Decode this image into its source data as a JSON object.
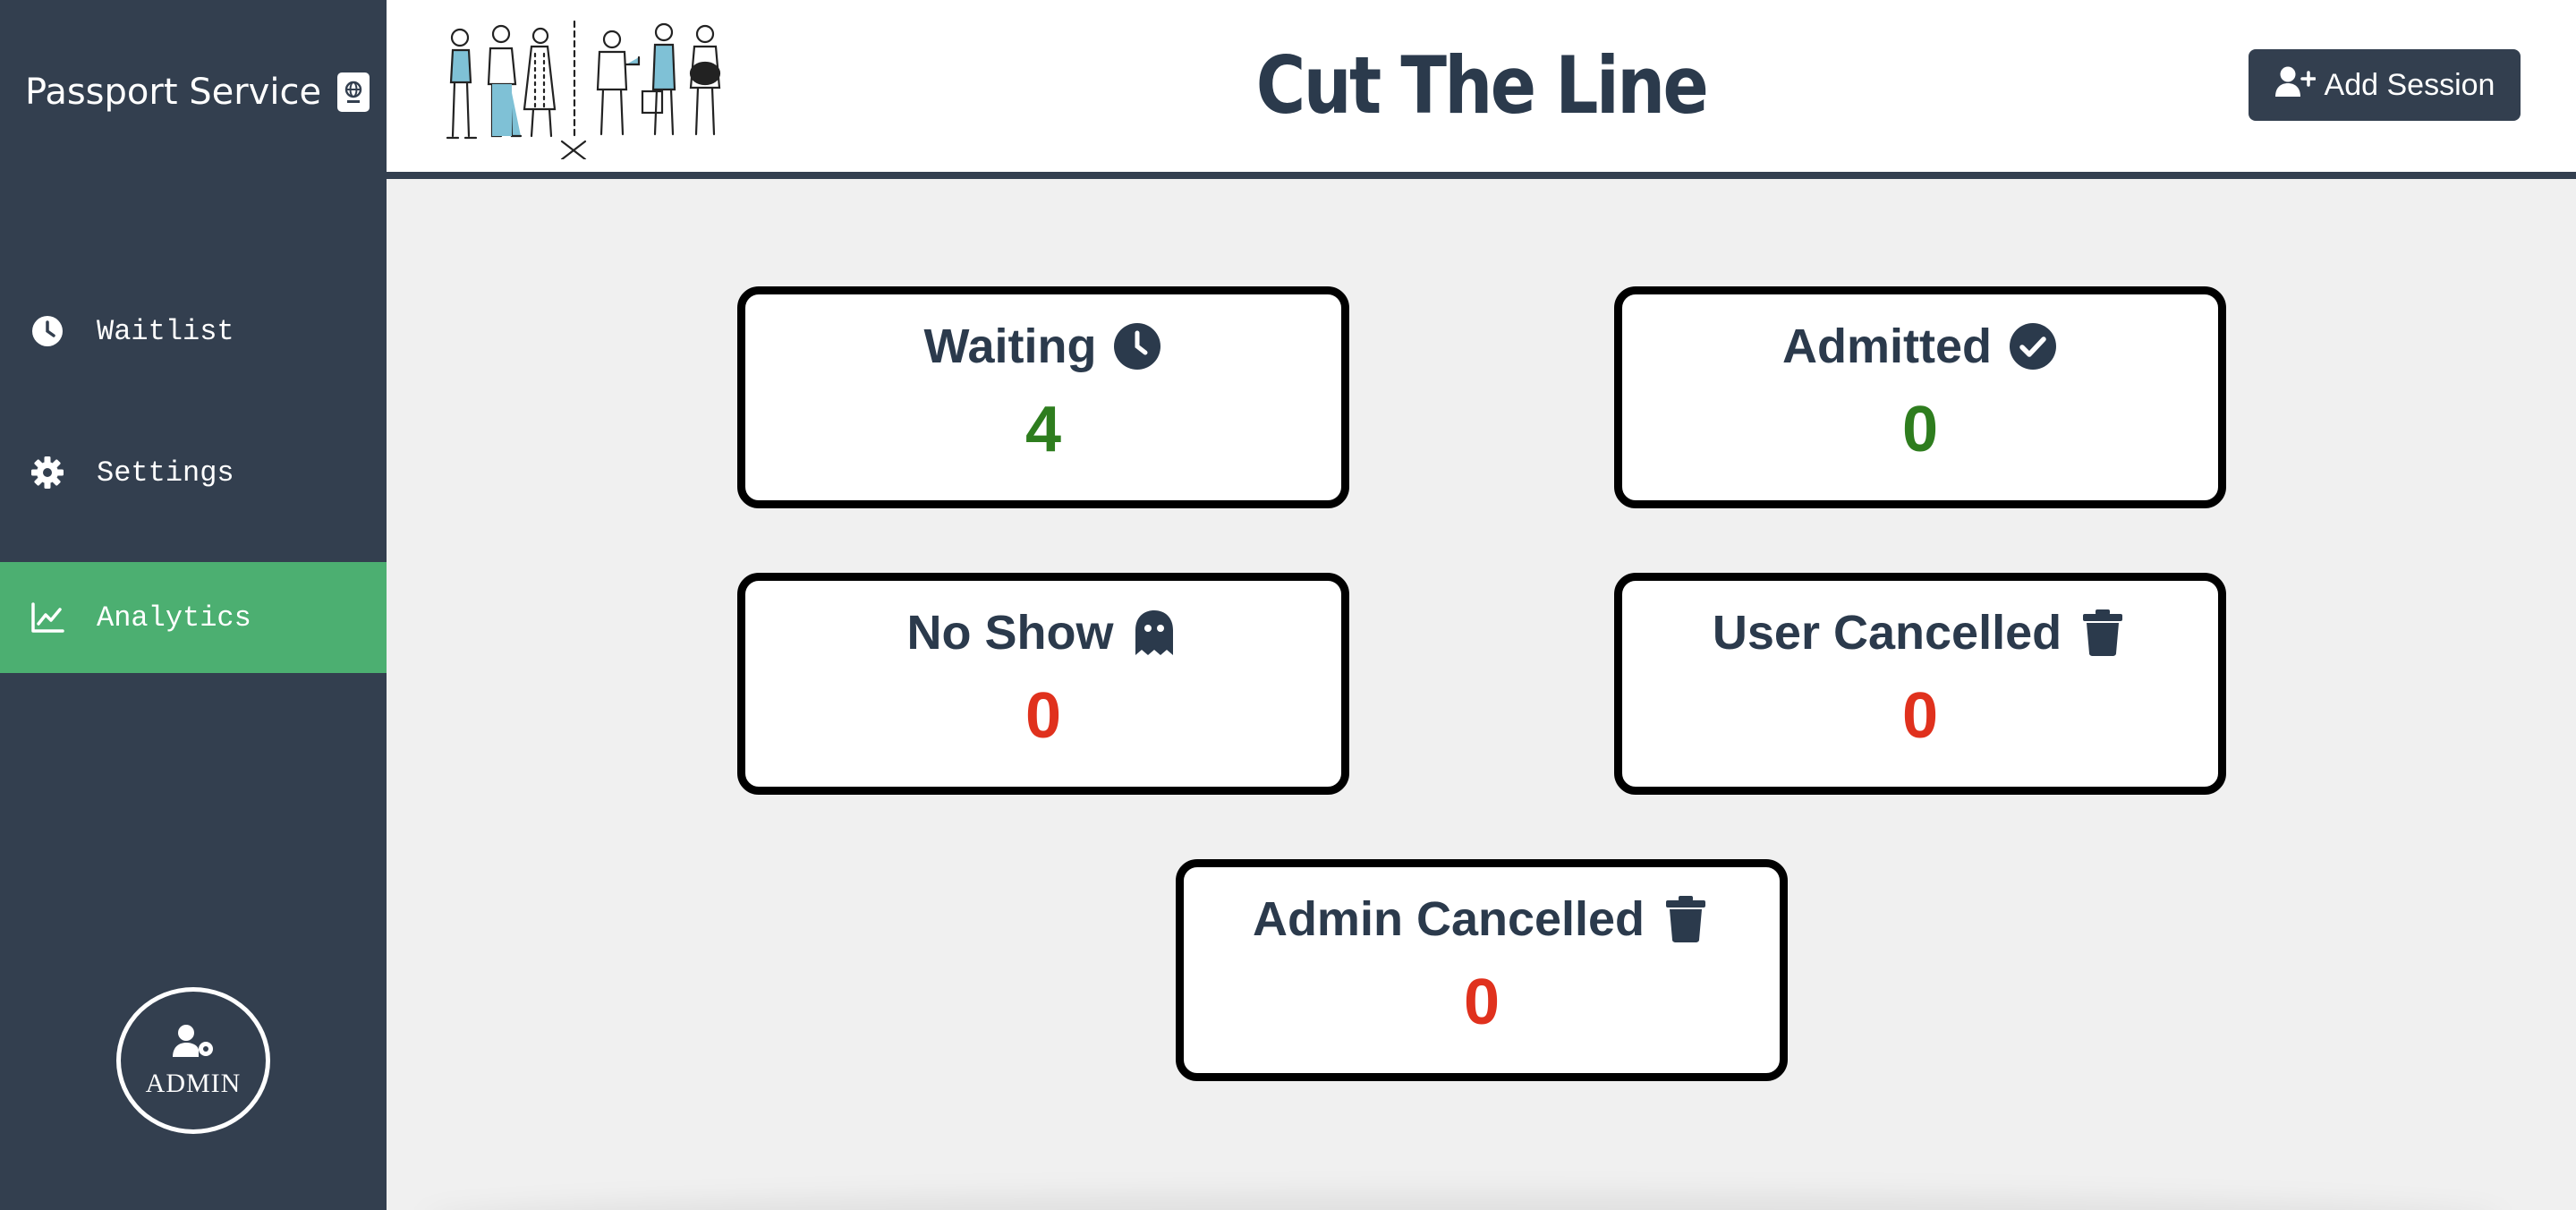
{
  "sidebar": {
    "brand": "Passport Service",
    "brand_icon": "passport-icon",
    "items": [
      {
        "label": "Waitlist",
        "icon": "clock-icon",
        "active": false
      },
      {
        "label": "Settings",
        "icon": "gear-icon",
        "active": false
      },
      {
        "label": "Analytics",
        "icon": "chart-line-icon",
        "active": true
      }
    ],
    "admin_label": "ADMIN"
  },
  "header": {
    "title": "Cut The Line",
    "add_session_label": "Add Session"
  },
  "cards": [
    {
      "label": "Waiting",
      "value": "4",
      "icon": "clock-icon",
      "value_color": "#2e7d1e"
    },
    {
      "label": "Admitted",
      "value": "0",
      "icon": "check-circle-icon",
      "value_color": "#2e7d1e"
    },
    {
      "label": "No Show",
      "value": "0",
      "icon": "ghost-icon",
      "value_color": "#e0311d"
    },
    {
      "label": "User Cancelled",
      "value": "0",
      "icon": "trash-icon",
      "value_color": "#e0311d"
    },
    {
      "label": "Admin Cancelled",
      "value": "0",
      "icon": "trash-icon",
      "value_color": "#e0311d"
    }
  ],
  "colors": {
    "sidebar_bg": "#333f4f",
    "active_nav": "#4caf71",
    "text_dark": "#2b3a4c"
  }
}
